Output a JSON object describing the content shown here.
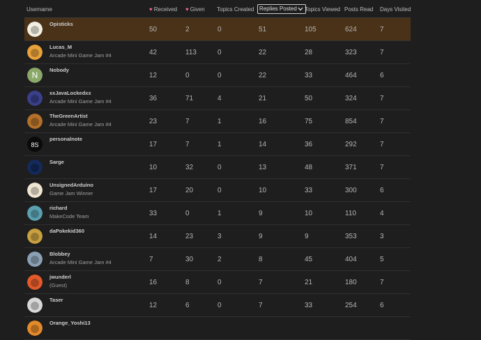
{
  "columns": {
    "username": "Username",
    "received": "Received",
    "given": "Given",
    "topics_created": "Topics Created",
    "replies_posted": "Replies Posted",
    "topics_viewed": "Topics Viewed",
    "posts_read": "Posts Read",
    "days_visited": "Days Visited"
  },
  "sort_column": "replies_posted",
  "icons": {
    "received": "heart-icon",
    "given": "heart-icon",
    "sort": "chevron-down-icon"
  },
  "colors": {
    "highlight_row": "#4a3218",
    "heart": "#e96a8c",
    "background": "#1e1e1e"
  },
  "rows": [
    {
      "username": "Opisticks",
      "title": "",
      "received": "50",
      "given": "2",
      "topics_created": "0",
      "replies_posted": "51",
      "topics_viewed": "105",
      "posts_read": "624",
      "days_visited": "7",
      "avatar": "opisticks-avatar",
      "avatar_letter": "",
      "avatar_color": "#f2efe2"
    },
    {
      "username": "Lucas_M",
      "title": "Arcade Mini Game Jam #4",
      "received": "42",
      "given": "113",
      "topics_created": "0",
      "replies_posted": "22",
      "topics_viewed": "28",
      "posts_read": "323",
      "days_visited": "7",
      "avatar": "lucas-avatar",
      "avatar_letter": "",
      "avatar_color": "#e8a23a"
    },
    {
      "username": "Nobody",
      "title": "",
      "received": "12",
      "given": "0",
      "topics_created": "0",
      "replies_posted": "22",
      "topics_viewed": "33",
      "posts_read": "464",
      "days_visited": "6",
      "avatar": "letter-avatar",
      "avatar_letter": "N",
      "avatar_color": "#8aa86a"
    },
    {
      "username": "xxJavaLockedxx",
      "title": "Arcade Mini Game Jam #4",
      "received": "36",
      "given": "71",
      "topics_created": "4",
      "replies_posted": "21",
      "topics_viewed": "50",
      "posts_read": "324",
      "days_visited": "7",
      "avatar": "javalocked-avatar",
      "avatar_letter": "",
      "avatar_color": "#3a3f8a"
    },
    {
      "username": "TheGreenArtist",
      "title": "Arcade Mini Game Jam #4",
      "received": "23",
      "given": "7",
      "topics_created": "1",
      "replies_posted": "16",
      "topics_viewed": "75",
      "posts_read": "854",
      "days_visited": "7",
      "avatar": "greenartist-avatar",
      "avatar_letter": "",
      "avatar_color": "#b3702a"
    },
    {
      "username": "personalnote",
      "title": "",
      "received": "17",
      "given": "7",
      "topics_created": "1",
      "replies_posted": "14",
      "topics_viewed": "36",
      "posts_read": "292",
      "days_visited": "7",
      "avatar": "personalnote-avatar",
      "avatar_letter": "8S",
      "avatar_color": "#0a0a0a"
    },
    {
      "username": "Sarge",
      "title": "",
      "received": "10",
      "given": "32",
      "topics_created": "0",
      "replies_posted": "13",
      "topics_viewed": "48",
      "posts_read": "371",
      "days_visited": "7",
      "avatar": "sarge-avatar",
      "avatar_letter": "",
      "avatar_color": "#142a5a"
    },
    {
      "username": "UnsignedArduino",
      "title": "Game Jam Winner",
      "received": "17",
      "given": "20",
      "topics_created": "0",
      "replies_posted": "10",
      "topics_viewed": "33",
      "posts_read": "300",
      "days_visited": "6",
      "avatar": "arduino-avatar",
      "avatar_letter": "",
      "avatar_color": "#efe6d2"
    },
    {
      "username": "richard",
      "title": "MakeCode Team",
      "received": "33",
      "given": "0",
      "topics_created": "1",
      "replies_posted": "9",
      "topics_viewed": "10",
      "posts_read": "110",
      "days_visited": "4",
      "avatar": "richard-avatar",
      "avatar_letter": "",
      "avatar_color": "#5aa0b0"
    },
    {
      "username": "daPokekid360",
      "title": "",
      "received": "14",
      "given": "23",
      "topics_created": "3",
      "replies_posted": "9",
      "topics_viewed": "9",
      "posts_read": "353",
      "days_visited": "3",
      "avatar": "pokekid-avatar",
      "avatar_letter": "",
      "avatar_color": "#c8a040"
    },
    {
      "username": "Blobbey",
      "title": "Arcade Mini Game Jam #4",
      "received": "7",
      "given": "30",
      "topics_created": "2",
      "replies_posted": "8",
      "topics_viewed": "45",
      "posts_read": "404",
      "days_visited": "5",
      "avatar": "blobbey-avatar",
      "avatar_letter": "",
      "avatar_color": "#8aa0b4"
    },
    {
      "username": "jwunderl",
      "title": "(Guest)",
      "received": "16",
      "given": "8",
      "topics_created": "0",
      "replies_posted": "7",
      "topics_viewed": "21",
      "posts_read": "180",
      "days_visited": "7",
      "avatar": "jwunderl-avatar",
      "avatar_letter": "",
      "avatar_color": "#e35a2a"
    },
    {
      "username": "Taser",
      "title": "",
      "received": "12",
      "given": "6",
      "topics_created": "0",
      "replies_posted": "7",
      "topics_viewed": "33",
      "posts_read": "254",
      "days_visited": "6",
      "avatar": "taser-avatar",
      "avatar_letter": "",
      "avatar_color": "#d8d8d8"
    },
    {
      "username": "Orange_Yoshi13",
      "title": "",
      "received": "",
      "given": "",
      "topics_created": "",
      "replies_posted": "",
      "topics_viewed": "",
      "posts_read": "",
      "days_visited": "",
      "avatar": "yoshi-avatar",
      "avatar_letter": "",
      "avatar_color": "#e38a2a"
    }
  ]
}
